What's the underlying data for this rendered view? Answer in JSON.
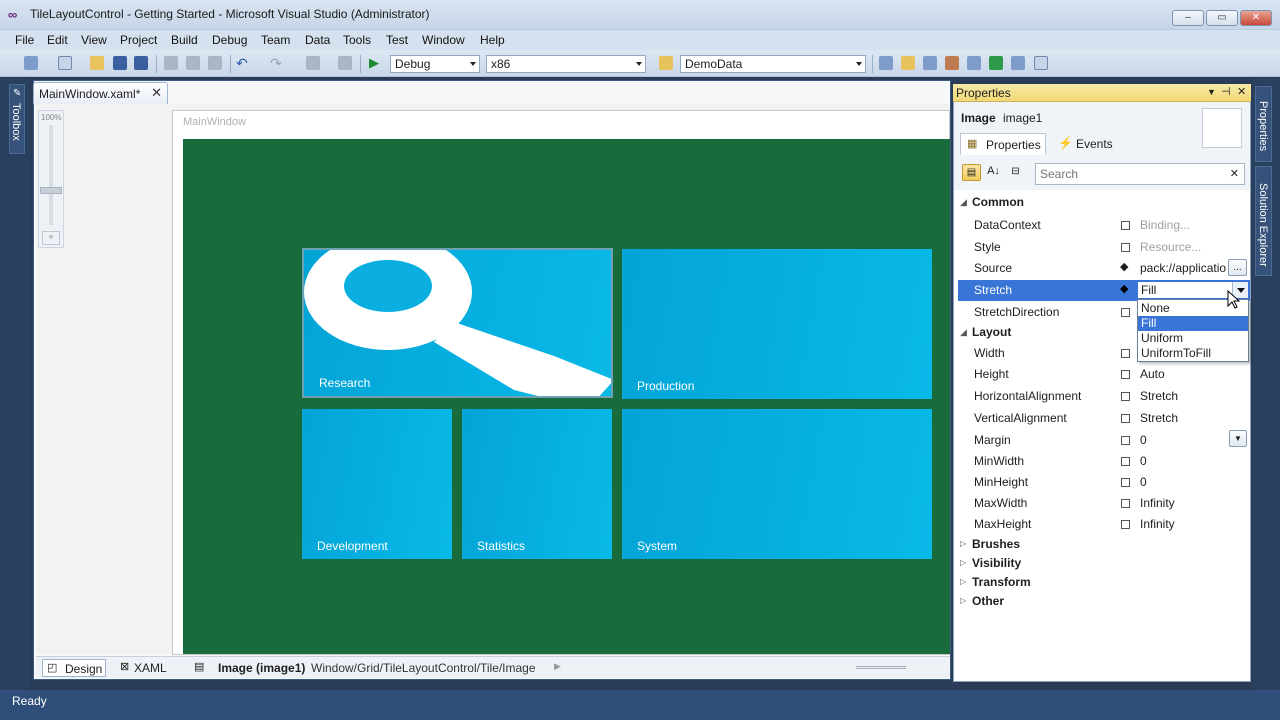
{
  "window": {
    "title": "TileLayoutControl - Getting Started - Microsoft Visual Studio (Administrator)",
    "min": "–",
    "max": "▭",
    "close": "✕"
  },
  "menu": [
    "File",
    "Edit",
    "View",
    "Project",
    "Build",
    "Debug",
    "Team",
    "Data",
    "Tools",
    "Test",
    "Window",
    "Help"
  ],
  "toolbar": {
    "config": "Debug",
    "platform": "x86",
    "startup": "DemoData"
  },
  "left": {
    "toolbox_label": "Toolbox"
  },
  "editor": {
    "tab_label": "MainWindow.xaml*",
    "tab_close": "✕",
    "zoom": "100%",
    "window_caption": "MainWindow"
  },
  "tiles": [
    {
      "label": "Research"
    },
    {
      "label": "Production"
    },
    {
      "label": "Development"
    },
    {
      "label": "Statistics"
    },
    {
      "label": "System"
    }
  ],
  "bottom": {
    "design_tab": "Design",
    "xaml_tab": "XAML",
    "element": "Image (image1)",
    "path": "Window/Grid/TileLayoutControl/Tile/Image"
  },
  "status": {
    "text": "Ready"
  },
  "right_tabs": {
    "properties": "Properties",
    "solution": "Solution Explorer"
  },
  "properties": {
    "panel_title": "Properties",
    "type_name": "Image",
    "object_name": "image1",
    "tab_properties": "Properties",
    "tab_events": "Events",
    "search_placeholder": "Search",
    "clear": "✕",
    "categories": {
      "common": "Common",
      "layout": "Layout",
      "brushes": "Brushes",
      "visibility": "Visibility",
      "transform": "Transform",
      "other": "Other"
    },
    "rows": {
      "datacontext": {
        "name": "DataContext",
        "value": "Binding..."
      },
      "style": {
        "name": "Style",
        "value": "Resource..."
      },
      "source": {
        "name": "Source",
        "value": "pack://applicatio"
      },
      "stretch": {
        "name": "Stretch",
        "value": "Fill"
      },
      "stretchdirection": {
        "name": "StretchDirection",
        "value": ""
      },
      "width": {
        "name": "Width",
        "value": ""
      },
      "height": {
        "name": "Height",
        "value": "Auto"
      },
      "halign": {
        "name": "HorizontalAlignment",
        "value": "Stretch"
      },
      "valign": {
        "name": "VerticalAlignment",
        "value": "Stretch"
      },
      "margin": {
        "name": "Margin",
        "value": "0"
      },
      "minwidth": {
        "name": "MinWidth",
        "value": "0"
      },
      "minheight": {
        "name": "MinHeight",
        "value": "0"
      },
      "maxwidth": {
        "name": "MaxWidth",
        "value": "Infinity"
      },
      "maxheight": {
        "name": "MaxHeight",
        "value": "Infinity"
      }
    },
    "stretch_options": [
      "None",
      "Fill",
      "Uniform",
      "UniformToFill"
    ],
    "ellipsis": "..."
  },
  "colors": {
    "selection": "#3875d7",
    "tile": "#07b0e2",
    "canvas": "#1a6b3c"
  }
}
